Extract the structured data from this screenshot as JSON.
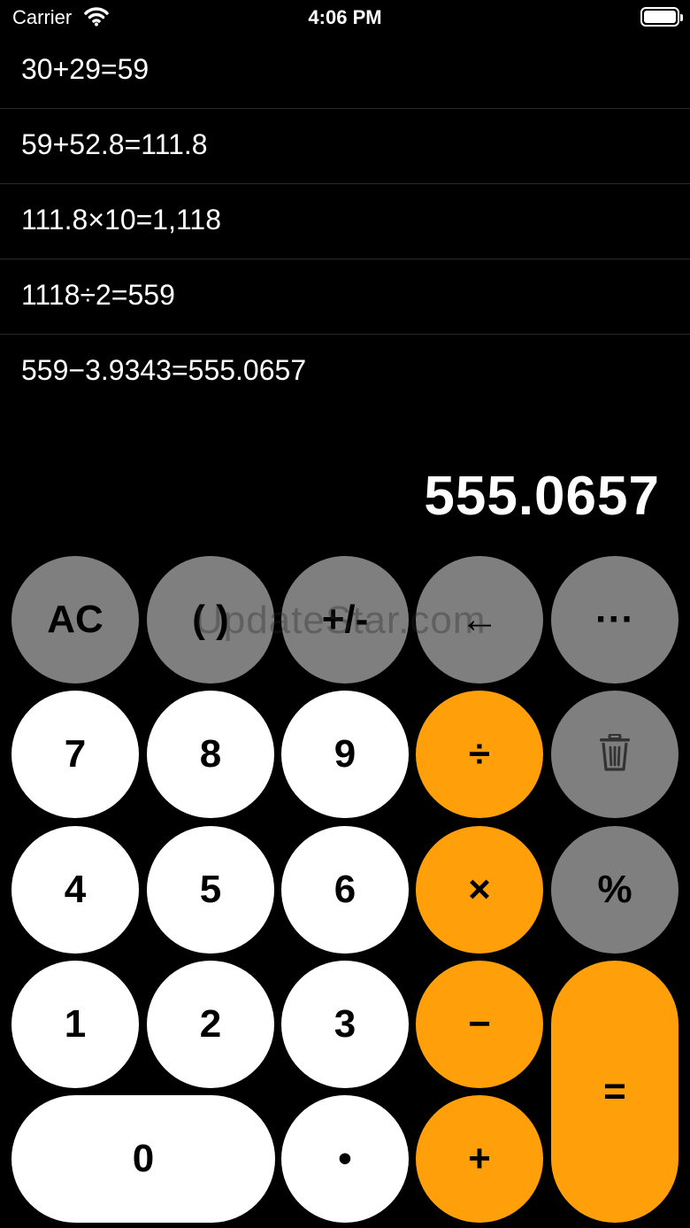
{
  "status_bar": {
    "carrier": "Carrier",
    "time": "4:06 PM"
  },
  "history": [
    "30+29=59",
    "59+52.8=111.8",
    "111.8×10=1,118",
    "1118÷2=559",
    "559−3.9343=555.0657"
  ],
  "display": {
    "value": "555.0657"
  },
  "keys": {
    "ac": "AC",
    "parens": "( )",
    "plus_minus": "+/-",
    "backspace": "←",
    "more": "···",
    "seven": "7",
    "eight": "8",
    "nine": "9",
    "divide": "÷",
    "four": "4",
    "five": "5",
    "six": "6",
    "multiply": "×",
    "percent": "%",
    "one": "1",
    "two": "2",
    "three": "3",
    "minus": "−",
    "equals": "=",
    "zero": "0",
    "decimal": "•",
    "plus": "+"
  },
  "watermark": "UpdateStar.com",
  "colors": {
    "operator": "#ff9f0a",
    "function": "#7f7f7f",
    "digit": "#ffffff",
    "background": "#000000"
  }
}
